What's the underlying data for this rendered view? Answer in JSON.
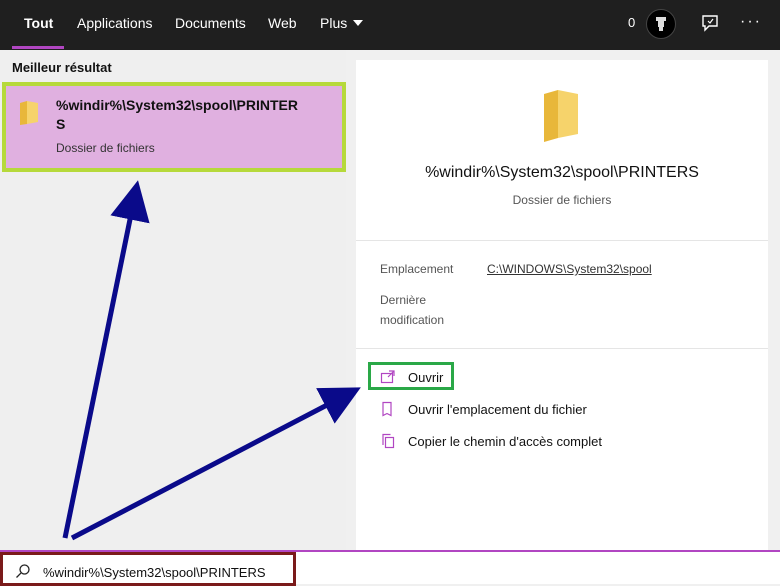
{
  "nav": {
    "tabs": [
      {
        "label": "Tout"
      },
      {
        "label": "Applications"
      },
      {
        "label": "Documents"
      },
      {
        "label": "Web"
      },
      {
        "label": "Plus"
      }
    ],
    "points": "0",
    "more_label": "···"
  },
  "best_result": {
    "section_label": "Meilleur résultat",
    "title": "%windir%\\System32\\spool\\PRINTERS",
    "subtitle": "Dossier de fichiers"
  },
  "detail": {
    "title": "%windir%\\System32\\spool\\PRINTERS",
    "subtitle": "Dossier de fichiers",
    "location_label": "Emplacement",
    "location_value": "C:\\WINDOWS\\System32\\spool",
    "modified_label": "Dernière modification"
  },
  "actions": [
    {
      "label": "Ouvrir",
      "icon": "open-icon"
    },
    {
      "label": "Ouvrir l'emplacement du fichier",
      "icon": "open-location-icon"
    },
    {
      "label": "Copier le chemin d'accès complet",
      "icon": "copy-path-icon"
    }
  ],
  "search": {
    "value": "%windir%\\System32\\spool\\PRINTERS"
  },
  "colors": {
    "accent": "#b146c2",
    "highlight_card": "#e0b0e0",
    "card_border": "#b6d93b",
    "open_border": "#2aa847",
    "search_border": "#7a1a1a",
    "arrow": "#0a0a8a"
  }
}
